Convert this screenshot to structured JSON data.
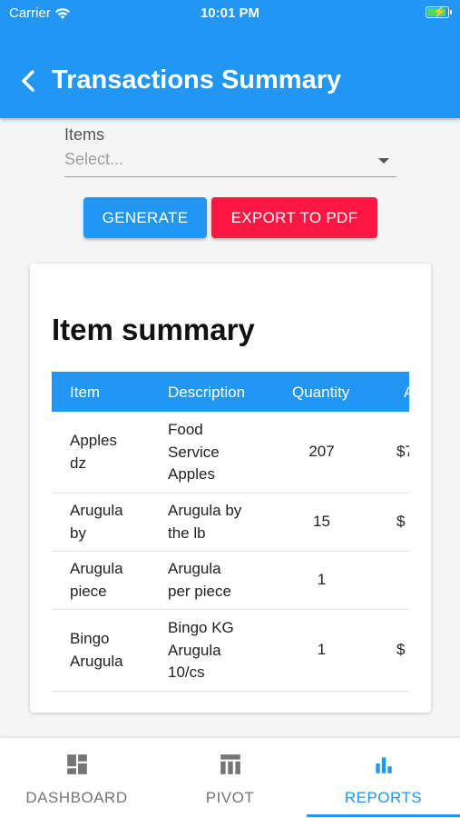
{
  "status_bar": {
    "carrier": "Carrier",
    "time": "10:01 PM"
  },
  "header": {
    "title": "Transactions Summary"
  },
  "filter": {
    "label": "Items",
    "placeholder": "Select..."
  },
  "actions": {
    "generate_label": "GENERATE",
    "export_label": "EXPORT TO PDF"
  },
  "summary": {
    "title": "Item summary",
    "columns": [
      "Item",
      "Description",
      "Quantity",
      "A"
    ],
    "rows": [
      {
        "item": [
          "Apples",
          "dz"
        ],
        "description": [
          "Food",
          "Service",
          "Apples"
        ],
        "quantity": "207",
        "amount": "$7"
      },
      {
        "item": [
          "Arugula",
          "by"
        ],
        "description": [
          "Arugula by",
          "the lb"
        ],
        "quantity": "15",
        "amount": "$"
      },
      {
        "item": [
          "Arugula",
          "piece"
        ],
        "description": [
          "Arugula",
          "per piece"
        ],
        "quantity": "1",
        "amount": ""
      },
      {
        "item": [
          "Bingo",
          "Arugula"
        ],
        "description": [
          "Bingo KG",
          "Arugula",
          "10/cs"
        ],
        "quantity": "1",
        "amount": "$"
      }
    ]
  },
  "bottom_nav": {
    "items": [
      {
        "label": "DASHBOARD",
        "icon": "dashboard-icon"
      },
      {
        "label": "PIVOT",
        "icon": "pivot-icon"
      },
      {
        "label": "REPORTS",
        "icon": "reports-icon"
      }
    ],
    "active": "REPORTS"
  },
  "colors": {
    "primary": "#2196f3",
    "accent": "#ff1744"
  }
}
